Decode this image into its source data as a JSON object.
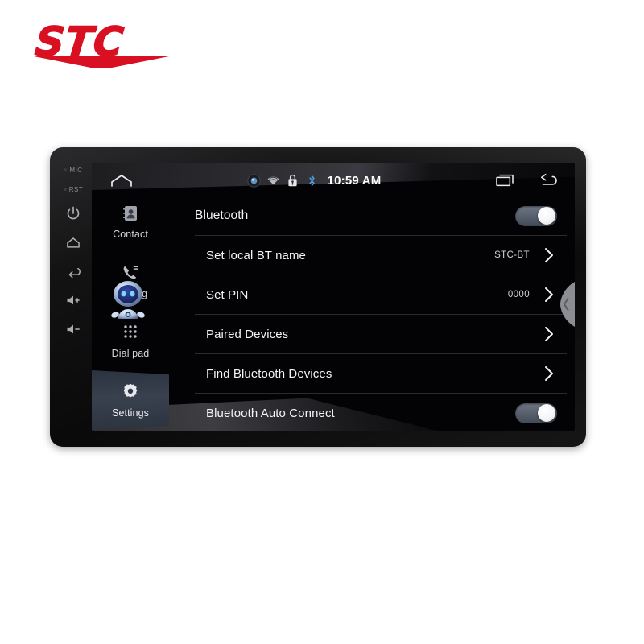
{
  "brand": {
    "wordmark": "STC",
    "color": "#d81022"
  },
  "device": {
    "bezel_buttons": [
      {
        "name": "mic-label",
        "label": "MIC",
        "type": "text"
      },
      {
        "name": "reset-label",
        "label": "RST",
        "type": "text"
      },
      {
        "name": "power-button",
        "label": "power-icon",
        "type": "icon"
      },
      {
        "name": "home-button",
        "label": "home-icon",
        "type": "icon"
      },
      {
        "name": "back-button",
        "label": "back-icon",
        "type": "icon"
      },
      {
        "name": "volume-up-button",
        "label": "volume-up-icon",
        "type": "icon"
      },
      {
        "name": "volume-down-button",
        "label": "volume-down-icon",
        "type": "icon"
      }
    ]
  },
  "status_bar": {
    "home_icon": "home-icon",
    "icons": [
      "location-icon",
      "wifi-icon",
      "usb-lock-icon",
      "bluetooth-icon"
    ],
    "clock": "10:59 AM",
    "nav": [
      {
        "name": "recent-apps-button",
        "icon": "recent-apps-icon"
      },
      {
        "name": "back-button",
        "icon": "back-arrow-icon"
      }
    ]
  },
  "sidebar": {
    "items": [
      {
        "label": "Contact",
        "icon": "contacts-icon",
        "active": false
      },
      {
        "label": "Call log",
        "icon": "call-log-icon",
        "active": false
      },
      {
        "label": "Dial pad",
        "icon": "dial-pad-icon",
        "active": false
      },
      {
        "label": "Settings",
        "icon": "gear-icon",
        "active": true
      }
    ],
    "assistant_avatar": "robot-assistant-icon"
  },
  "settings": {
    "rows": [
      {
        "title": "Bluetooth",
        "value": "",
        "control": "toggle",
        "toggle_on": true,
        "header": true
      },
      {
        "title": "Set local BT name",
        "value": "STC-BT",
        "control": "chevron",
        "toggle_on": false,
        "header": false
      },
      {
        "title": "Set PIN",
        "value": "0000",
        "control": "chevron",
        "toggle_on": false,
        "header": false
      },
      {
        "title": "Paired Devices",
        "value": "",
        "control": "chevron",
        "toggle_on": false,
        "header": false
      },
      {
        "title": "Find Bluetooth Devices",
        "value": "",
        "control": "chevron",
        "toggle_on": false,
        "header": false
      },
      {
        "title": "Bluetooth Auto Connect",
        "value": "",
        "control": "toggle",
        "toggle_on": true,
        "header": false
      }
    ]
  },
  "right_tab": {
    "icon": "chevron-left-icon"
  }
}
